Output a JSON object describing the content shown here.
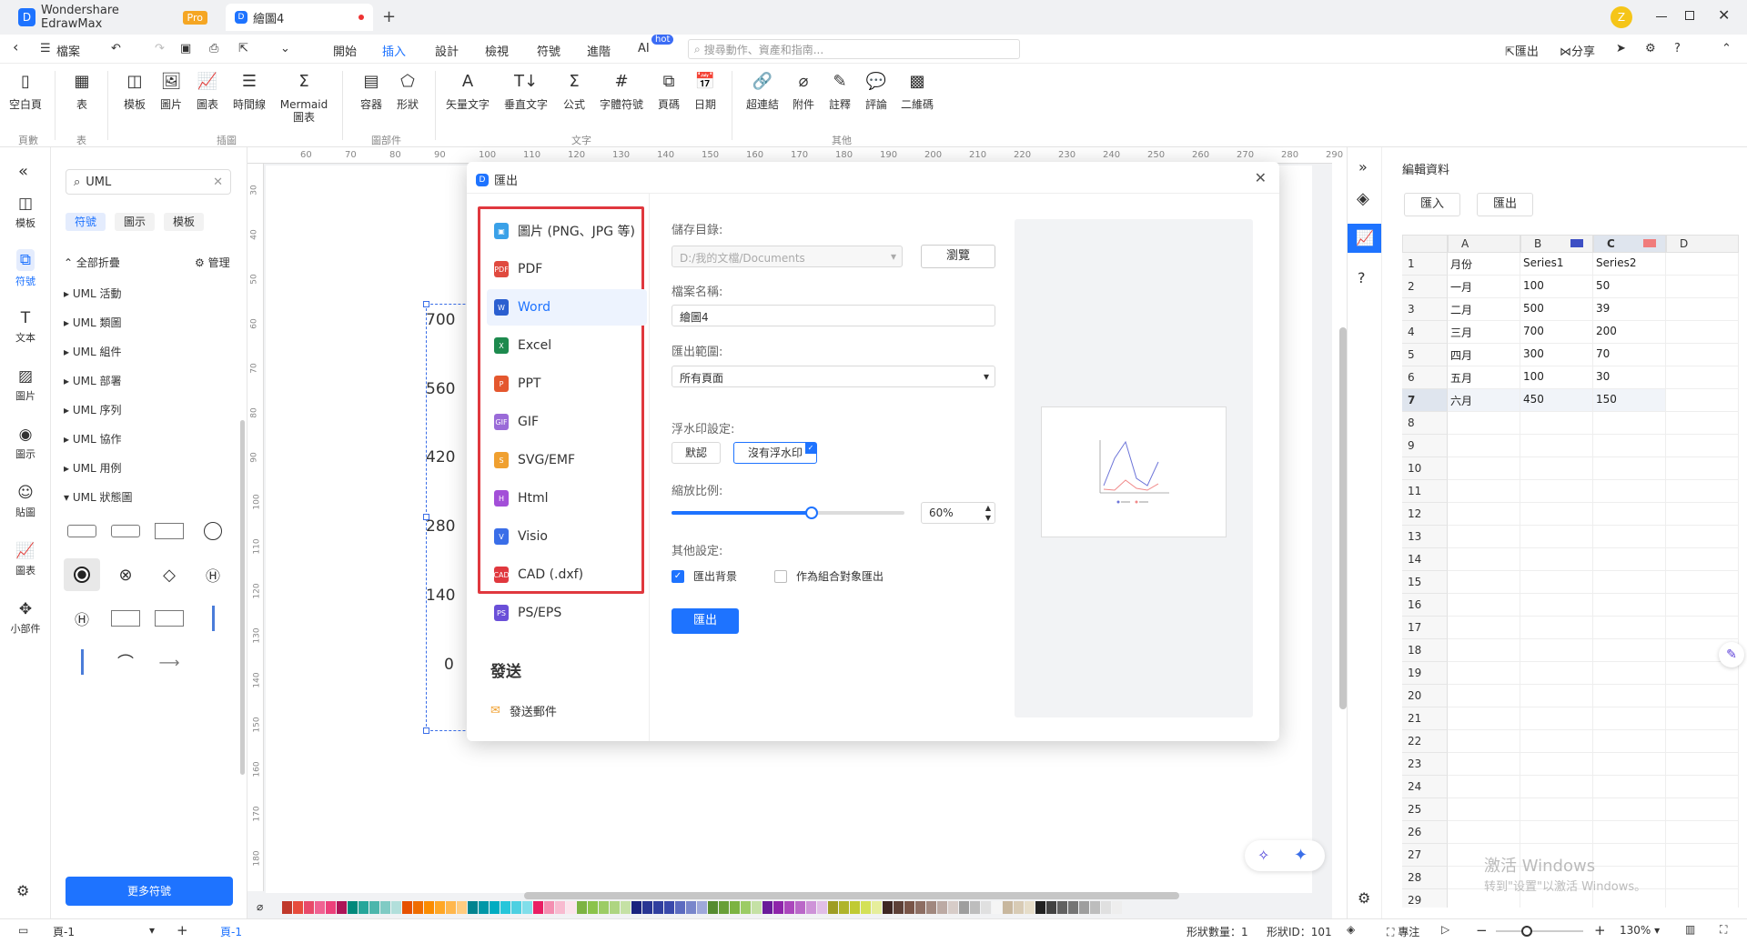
{
  "titlebar": {
    "app_tab": "Wondershare EdrawMax",
    "pro_badge": "Pro",
    "doc_tab": "繪圖4",
    "new_tab": "+"
  },
  "menubar": {
    "file": "檔案",
    "tabs": [
      "開始",
      "插入",
      "設計",
      "檢視",
      "符號",
      "進階",
      "AI"
    ],
    "ai_badge": "hot",
    "active_tab": "插入",
    "search_placeholder": "搜尋動作、資產和指南...",
    "export_label": "匯出",
    "share_label": "分享"
  },
  "ribbon": {
    "buttons": [
      "空白頁",
      "表",
      "模板",
      "圖片",
      "圖表",
      "時間線",
      "Mermaid 圖表",
      "容器",
      "形狀",
      "矢量文字",
      "垂直文字",
      "公式",
      "字體符號",
      "頁碼",
      "日期",
      "超連結",
      "附件",
      "註釋",
      "評論",
      "二維碼"
    ],
    "groups": [
      "頁數",
      "表",
      "插圖",
      "圖部件",
      "文字",
      "其他"
    ]
  },
  "rail": {
    "items": [
      "模板",
      "符號",
      "文本",
      "圖片",
      "圖示",
      "貼圖",
      "圖表",
      "小部件"
    ],
    "active": "符號"
  },
  "library": {
    "search_value": "UML",
    "tabs": [
      "符號",
      "圖示",
      "模板"
    ],
    "collapse_all": "全部折疊",
    "manage": "管理",
    "items": [
      "UML 活動",
      "UML 類圖",
      "UML 組件",
      "UML 部署",
      "UML 序列",
      "UML 協作",
      "UML 用例",
      "UML 狀態圖"
    ],
    "more_button": "更多符號"
  },
  "rulers": {
    "top": [
      "60",
      "70",
      "80",
      "90",
      "100",
      "110",
      "120",
      "130",
      "140",
      "150",
      "160",
      "170",
      "180",
      "190",
      "200",
      "210",
      "220",
      "230",
      "240",
      "250",
      "260",
      "270",
      "280",
      "290"
    ],
    "left": [
      "30",
      "40",
      "50",
      "60",
      "70",
      "80",
      "90",
      "100",
      "110",
      "120",
      "130",
      "140",
      "150",
      "160",
      "170",
      "180"
    ]
  },
  "canvas_chart": {
    "ticks": [
      "700",
      "560",
      "420",
      "280",
      "140",
      "0"
    ]
  },
  "dialog": {
    "title": "匯出",
    "formats": [
      "圖片 (PNG、JPG 等)",
      "PDF",
      "Word",
      "Excel",
      "PPT",
      "GIF",
      "SVG/EMF",
      "Html",
      "Visio",
      "CAD (.dxf)",
      "PS/EPS"
    ],
    "selected_format": "Word",
    "send_heading": "發送",
    "send_mail": "發送郵件",
    "save_dir_label": "儲存目錄:",
    "save_dir_value": "D:/我的文檔/Documents",
    "browse_button": "瀏覽",
    "filename_label": "檔案名稱:",
    "filename_value": "繪圖4",
    "range_label": "匯出範圍:",
    "range_value": "所有頁面",
    "watermark_label": "浮水印設定:",
    "watermark_default": "默認",
    "watermark_none": "沒有浮水印",
    "scale_label": "縮放比例:",
    "scale_value": "60%",
    "scale_fraction": 0.6,
    "other_label": "其他設定:",
    "export_bg": "匯出背景",
    "export_bg_checked": true,
    "as_group": "作為組合對象匯出",
    "as_group_checked": false,
    "export_button": "匯出"
  },
  "rightpanel": {
    "title": "編輯資料",
    "import_button": "匯入",
    "export_button": "匯出",
    "col_headers": [
      "A",
      "B",
      "C",
      "D"
    ],
    "row_numbers": [
      "1",
      "2",
      "3",
      "4",
      "5",
      "6",
      "7",
      "8",
      "9",
      "10",
      "11",
      "12",
      "13",
      "14",
      "15",
      "16",
      "17",
      "18",
      "19",
      "20",
      "21",
      "22",
      "23",
      "24",
      "25",
      "26",
      "27",
      "28",
      "29"
    ],
    "rows": [
      [
        "月份",
        "Series1",
        "Series2"
      ],
      [
        "一月",
        "100",
        "50"
      ],
      [
        "二月",
        "500",
        "39"
      ],
      [
        "三月",
        "700",
        "200"
      ],
      [
        "四月",
        "300",
        "70"
      ],
      [
        "五月",
        "100",
        "30"
      ],
      [
        "六月",
        "450",
        "150"
      ]
    ],
    "series_colors": {
      "series1": "#3d4fc4",
      "series2": "#f07c7c"
    }
  },
  "watermark_text": {
    "line1": "激活 Windows",
    "line2": "转到\"设置\"以激活 Windows。"
  },
  "statusbar": {
    "page_select": "頁-1",
    "page_tab": "頁-1",
    "shape_count": "形狀數量：1",
    "shape_id": "形狀ID：101",
    "focus": "專注",
    "zoom": "130%"
  }
}
